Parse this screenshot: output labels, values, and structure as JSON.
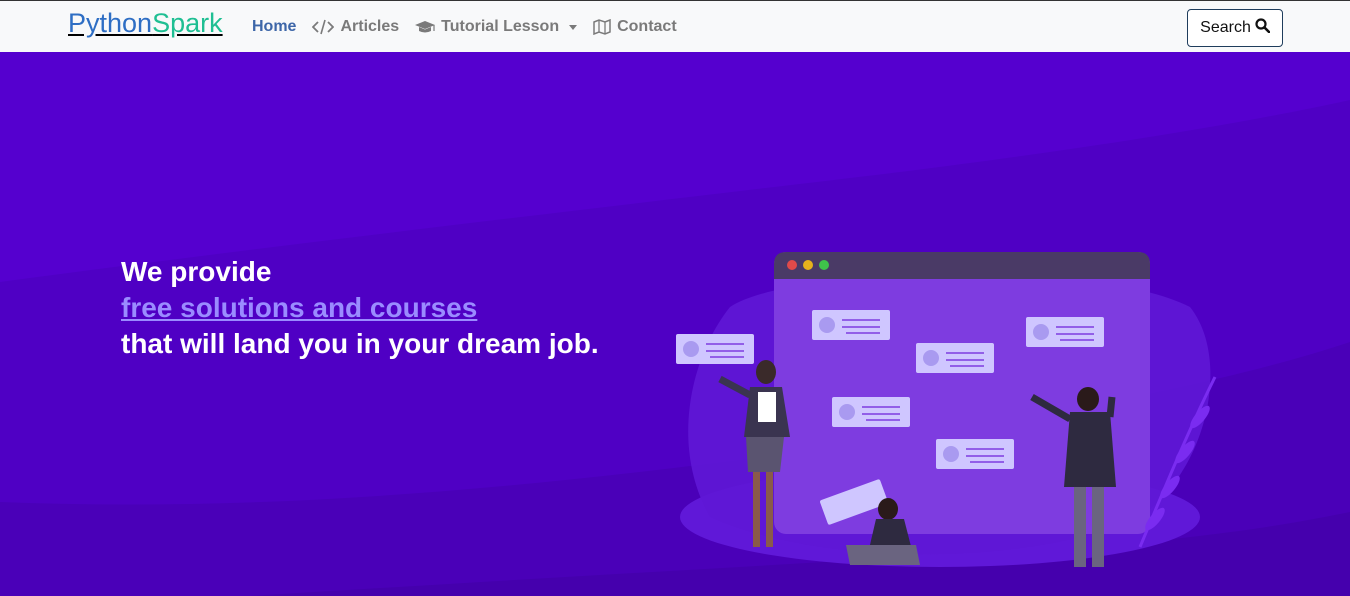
{
  "brand": {
    "part1": "Python",
    "part2": "Spark"
  },
  "nav": [
    {
      "label": "Home",
      "icon": "none",
      "active": true
    },
    {
      "label": "Articles",
      "icon": "code-icon"
    },
    {
      "label": "Tutorial Lesson",
      "icon": "graduation-cap-icon",
      "dropdown": true
    },
    {
      "label": "Contact",
      "icon": "map-icon"
    }
  ],
  "search": {
    "label": "Search"
  },
  "hero": {
    "line1": "We provide",
    "link": "free solutions and courses",
    "line3": "that will land you in your dream job."
  },
  "colors": {
    "hero_bg": "#5500cf",
    "brand_blue": "#2e6ec4",
    "brand_green": "#1fbf93",
    "link": "#9a8cff"
  }
}
